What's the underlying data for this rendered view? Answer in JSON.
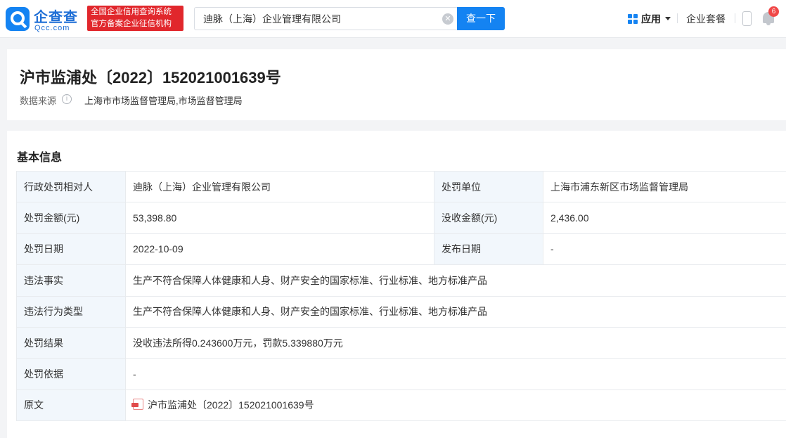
{
  "header": {
    "logo_cn": "企查查",
    "logo_en": "Qcc.com",
    "badge_line1": "全国企业信用查询系统",
    "badge_line2": "官方备案企业征信机构",
    "search_value": "迪脉（上海）企业管理有限公司",
    "search_button": "查一下",
    "apps_label": "应用",
    "package_label": "企业套餐",
    "notification_count": "6"
  },
  "title_card": {
    "title": "沪市监浦处〔2022〕152021001639号",
    "source_label": "数据来源",
    "source_value": "上海市市场监督管理局,市场监督管理局"
  },
  "basic_info": {
    "section_title": "基本信息",
    "rows": [
      {
        "label": "行政处罚相对人",
        "value": "迪脉（上海）企业管理有限公司",
        "label2": "处罚单位",
        "value2": "上海市浦东新区市场监督管理局"
      },
      {
        "label": "处罚金额(元)",
        "value": "53,398.80",
        "label2": "没收金额(元)",
        "value2": "2,436.00"
      },
      {
        "label": "处罚日期",
        "value": "2022-10-09",
        "label2": "发布日期",
        "value2": "-"
      },
      {
        "label": "违法事实",
        "value": "生产不符合保障人体健康和人身、财产安全的国家标准、行业标准、地方标准产品"
      },
      {
        "label": "违法行为类型",
        "value": "生产不符合保障人体健康和人身、财产安全的国家标准、行业标准、地方标准产品"
      },
      {
        "label": "处罚结果",
        "value": "没收违法所得0.243600万元，罚款5.339880万元"
      },
      {
        "label": "处罚依据",
        "value": "-"
      },
      {
        "label": "原文",
        "value": "沪市监浦处〔2022〕152021001639号"
      }
    ]
  },
  "colors": {
    "brand_blue": "#1483f2",
    "badge_red": "#e1272c",
    "link_blue": "#1f6fd6",
    "label_bg": "#f2f7fc"
  }
}
